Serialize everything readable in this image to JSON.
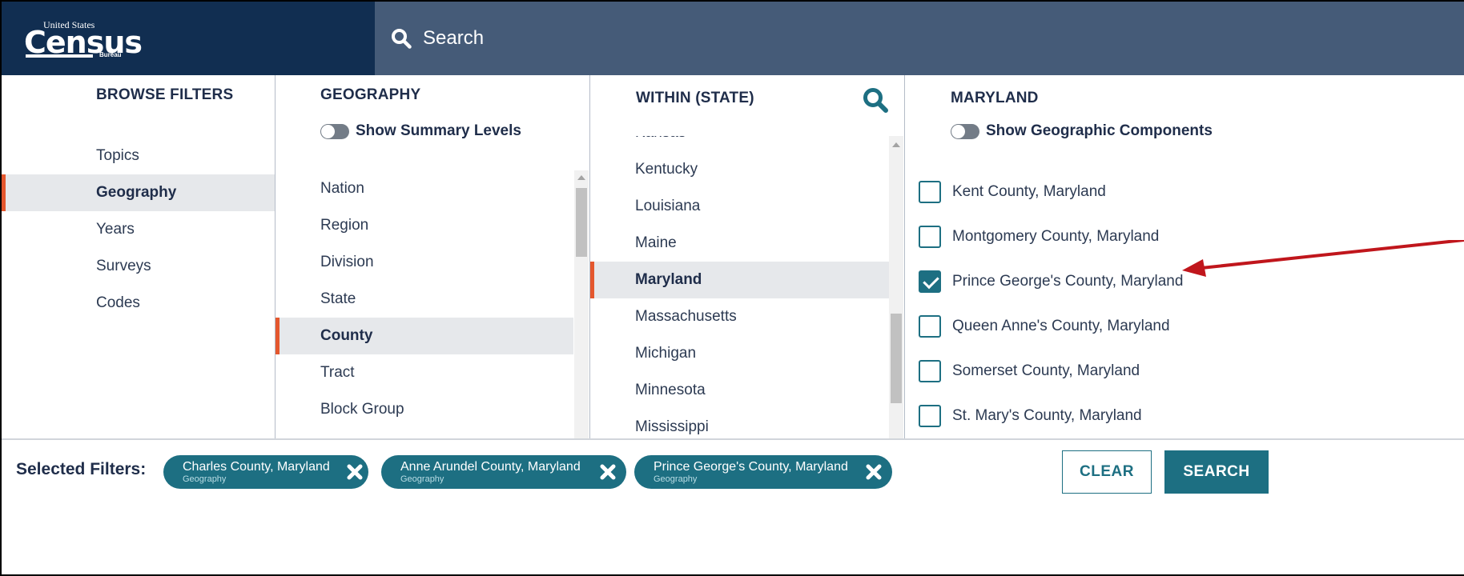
{
  "header": {
    "logo": {
      "line1": "United States",
      "line2": "Census",
      "line3": "Bureau"
    },
    "search": {
      "label": "Search",
      "icon": "search-icon"
    }
  },
  "browse": {
    "title": "BROWSE FILTERS",
    "items": [
      {
        "label": "Topics",
        "active": false
      },
      {
        "label": "Geography",
        "active": true
      },
      {
        "label": "Years",
        "active": false
      },
      {
        "label": "Surveys",
        "active": false
      },
      {
        "label": "Codes",
        "active": false
      }
    ]
  },
  "geography": {
    "title": "GEOGRAPHY",
    "toggle_label": "Show Summary Levels",
    "items": [
      {
        "label": "Nation"
      },
      {
        "label": "Region"
      },
      {
        "label": "Division"
      },
      {
        "label": "State"
      },
      {
        "label": "County",
        "active": true
      },
      {
        "label": "Tract"
      },
      {
        "label": "Block Group"
      }
    ]
  },
  "within_state": {
    "title": "WITHIN (STATE)",
    "items": [
      {
        "label": "Kansas"
      },
      {
        "label": "Kentucky"
      },
      {
        "label": "Louisiana"
      },
      {
        "label": "Maine"
      },
      {
        "label": "Maryland",
        "active": true
      },
      {
        "label": "Massachusetts"
      },
      {
        "label": "Michigan"
      },
      {
        "label": "Minnesota"
      },
      {
        "label": "Mississippi"
      }
    ]
  },
  "maryland": {
    "title": "MARYLAND",
    "toggle_label": "Show Geographic Components",
    "items": [
      {
        "label": "Kent County, Maryland",
        "checked": false
      },
      {
        "label": "Montgomery County, Maryland",
        "checked": false
      },
      {
        "label": "Prince George's County, Maryland",
        "checked": true
      },
      {
        "label": "Queen Anne's County, Maryland",
        "checked": false
      },
      {
        "label": "Somerset County, Maryland",
        "checked": false
      },
      {
        "label": "St. Mary's County, Maryland",
        "checked": false
      }
    ]
  },
  "footer": {
    "selected_label": "Selected Filters:",
    "chips": [
      {
        "name": "Charles County, Maryland",
        "type": "Geography"
      },
      {
        "name": "Anne Arundel County, Maryland",
        "type": "Geography"
      },
      {
        "name": "Prince George's County, Maryland",
        "type": "Geography"
      }
    ],
    "clear_label": "CLEAR",
    "search_label": "SEARCH"
  },
  "colors": {
    "navy": "#112e51",
    "search_bar": "#455b78",
    "teal": "#1d6f82",
    "accent": "#e4572e",
    "annotation_arrow": "#c0161c"
  }
}
